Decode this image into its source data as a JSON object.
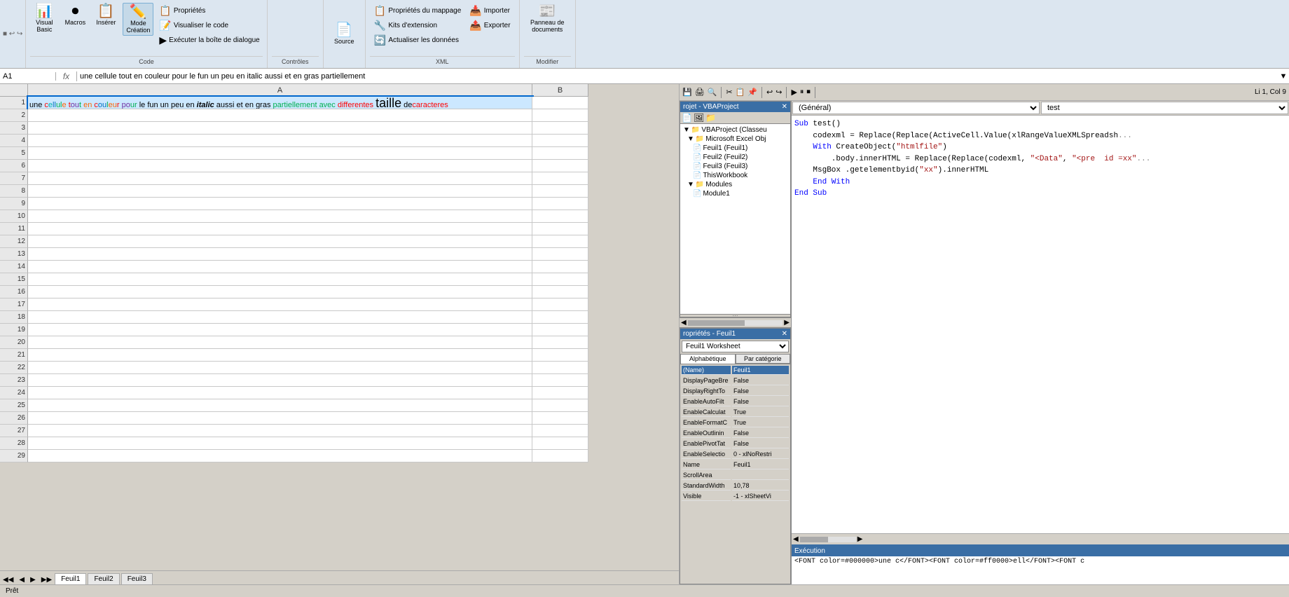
{
  "ribbon": {
    "groups": [
      {
        "name": "Code",
        "label": "Code",
        "buttons": [
          {
            "id": "visual-basic",
            "label": "Visual Basic",
            "icon": "📊"
          },
          {
            "id": "macros",
            "label": "Macros",
            "icon": "⏺"
          },
          {
            "id": "inserer",
            "label": "Insérer",
            "icon": "📋"
          }
        ],
        "small_buttons": [
          {
            "id": "proprietes",
            "label": "Propriétés",
            "icon": "📋"
          },
          {
            "id": "visualiser-code",
            "label": "Visualiser le code",
            "icon": "📝"
          },
          {
            "id": "executer-boite",
            "label": "Exécuter la boîte de dialogue",
            "icon": "▶"
          }
        ]
      },
      {
        "name": "Controles",
        "label": "Contrôles",
        "small_buttons": []
      },
      {
        "name": "XML",
        "label": "XML",
        "small_buttons": [
          {
            "id": "proprietes-mappage",
            "label": "Propriétés du mappage",
            "icon": "📋"
          },
          {
            "id": "kits-extension",
            "label": "Kits d'extension",
            "icon": "🔧"
          },
          {
            "id": "actualiser-donnees",
            "label": "Actualiser les données",
            "icon": "🔄"
          },
          {
            "id": "importer",
            "label": "Importer",
            "icon": "📥"
          },
          {
            "id": "exporter",
            "label": "Exporter",
            "icon": "📤"
          }
        ]
      }
    ],
    "mode_creation": {
      "label": "Mode\nCréation",
      "icon": "✏️"
    },
    "source": {
      "label": "Source",
      "icon": "📄"
    },
    "panneau_documents": {
      "label": "Panneau de\ndocuments",
      "icon": "📰"
    },
    "modifier_label": "Modifier"
  },
  "formula_bar": {
    "cell_ref": "A1",
    "fx_label": "fx",
    "formula": "une cellule tout en couleur pour le fun  un peu en italic aussi et en gras  partiellement"
  },
  "spreadsheet": {
    "columns": [
      "A",
      "B"
    ],
    "row1_content": "une cellule tout en couleur pour le fun  un peu en italic aussi et en gras  partiellement avec differentes taille de caracteres",
    "sheet_tabs": [
      "Feuil1",
      "Feuil2",
      "Feuil3"
    ]
  },
  "vba": {
    "project_title": "rojet - VBAProject",
    "close_btn": "✕",
    "tree": [
      {
        "label": "VBAProject (Classeu",
        "indent": 0,
        "icon": "📁",
        "expanded": true
      },
      {
        "label": "Microsoft Excel Obj",
        "indent": 1,
        "icon": "📁",
        "expanded": true
      },
      {
        "label": "Feuil1 (Feuil1)",
        "indent": 2,
        "icon": "📄"
      },
      {
        "label": "Feuil2 (Feuil2)",
        "indent": 2,
        "icon": "📄"
      },
      {
        "label": "Feuil3 (Feuil3)",
        "indent": 2,
        "icon": "📄"
      },
      {
        "label": "ThisWorkbook",
        "indent": 2,
        "icon": "📄"
      },
      {
        "label": "Modules",
        "indent": 1,
        "icon": "📁",
        "expanded": true
      },
      {
        "label": "Module1",
        "indent": 2,
        "icon": "📄"
      }
    ],
    "properties_title": "ropriétés - Feuil1",
    "properties_dropdown": "Feuil1  Worksheet",
    "props_tab_alpha": "Alphabétique",
    "props_tab_cat": "Par catégorie",
    "properties": [
      {
        "name": "(Name)",
        "value": "Feuil1",
        "selected": true
      },
      {
        "name": "DisplayPageBre",
        "value": "False"
      },
      {
        "name": "DisplayRightTo",
        "value": "False"
      },
      {
        "name": "EnableAutoFilt",
        "value": "False"
      },
      {
        "name": "EnableCalculat",
        "value": "True"
      },
      {
        "name": "EnableFormatC",
        "value": "True"
      },
      {
        "name": "EnableOutlinin",
        "value": "False"
      },
      {
        "name": "EnablePivotTat",
        "value": "False"
      },
      {
        "name": "EnableSelectio",
        "value": "0 - xlNoRestri"
      },
      {
        "name": "Name",
        "value": "Feuil1"
      },
      {
        "name": "ScrollArea",
        "value": ""
      },
      {
        "name": "StandardWidth",
        "value": "10,78"
      },
      {
        "name": "Visible",
        "value": "-1 - xlSheetVi"
      }
    ],
    "code_dropdown_left": "(Général)",
    "code_dropdown_right": "test",
    "code_lines": [
      "Sub test()",
      "    codexml = Replace(Replace(ActiveCell.Value(xlRangeValueXMLSpreadsh",
      "    With CreateObject(\"htmlfile\")",
      "        .body.innerHTML = Replace(Replace(codexml, \"<Data\", \"<pre  id =xx\"",
      "    MsgBox .getelementbyid(\"xx\").innerHTML",
      "    End With",
      "End Sub"
    ],
    "cursor_pos": "Li 1, Col 9",
    "execution_title": "Exécution",
    "execution_content": "<FONT color=#000000>une c</FONT><FONT color=#ff0000>ell</FONT><FONT c"
  }
}
